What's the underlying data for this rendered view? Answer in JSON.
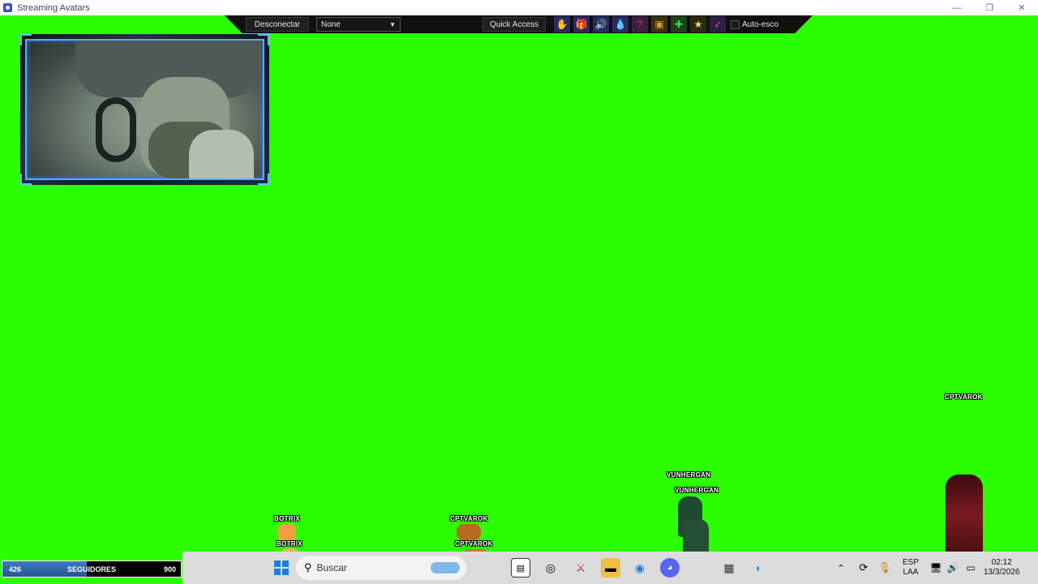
{
  "window": {
    "title": "Streaming Avatars",
    "minimize": "—",
    "restore": "❐",
    "close": "✕"
  },
  "toolbar": {
    "disconnect_label": "Desconectar",
    "select_value": "None",
    "quick_access_label": "Quick Access",
    "auto_label": "Auto-esco",
    "icons": [
      "hand-icon",
      "gift-icon",
      "speaker-icon",
      "drop-icon",
      "question-icon",
      "box-icon",
      "plant-icon",
      "star-icon",
      "rocket-icon"
    ]
  },
  "avatars": [
    {
      "name": "BOTRIX",
      "label_top": "BOTRIX",
      "label_bottom": "BOTRIX"
    },
    {
      "name": "CPTVAROK",
      "label_top": "CPTVAROK",
      "label_bottom": "CPTVAROK"
    },
    {
      "name": "VUNHERGAN",
      "label_top": "VUNHERGAN",
      "label_bottom": "VUNHERGAN"
    },
    {
      "name": "CPTVAROK",
      "label_top": "CPTVAROK"
    }
  ],
  "followers": {
    "current": "426",
    "label": "SEGUIDORES",
    "goal": "900",
    "progress": 0.473
  },
  "taskbar": {
    "search_placeholder": "Buscar",
    "language_top": "ESP",
    "language_bottom": "LAA",
    "time": "02:12",
    "date": "13/3/2026"
  },
  "colors": {
    "chroma": "#2bff00",
    "toolbar": "#101010",
    "frame_glow": "#5fa8ff",
    "follower_fill": "#3c7ac0"
  }
}
